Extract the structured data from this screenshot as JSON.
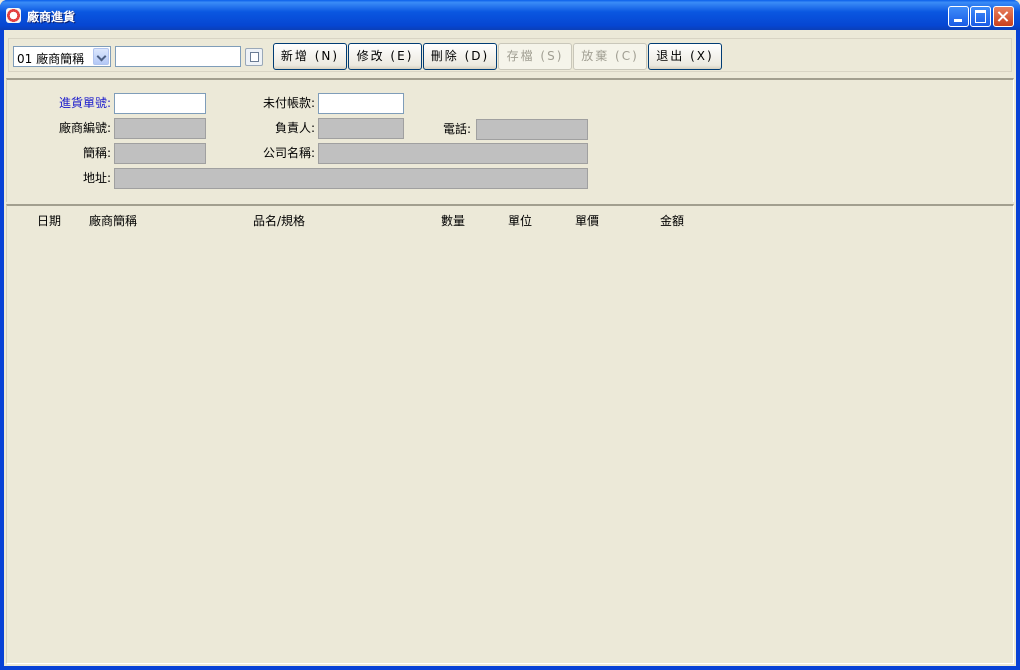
{
  "window": {
    "title": "廠商進貨"
  },
  "toolbar": {
    "combo_selected": "01 廠商簡稱",
    "search_value": "",
    "buttons": {
      "add": "新增 (N)",
      "edit": "修改 (E)",
      "delete": "刪除 (D)",
      "save": "存檔 (S)",
      "cancel": "放棄 (C)",
      "exit": "退出 (X)"
    }
  },
  "form": {
    "purchase_no_label": "進貨單號:",
    "purchase_no_value": "",
    "unpaid_label": "未付帳款:",
    "unpaid_value": "",
    "vendor_no_label": "廠商編號:",
    "vendor_no_value": "",
    "person_in_charge_label": "負責人:",
    "person_in_charge_value": "",
    "phone_label": "電話:",
    "phone_value": "",
    "short_name_label": "簡稱:",
    "short_name_value": "",
    "company_name_label": "公司名稱:",
    "company_name_value": "",
    "address_label": "地址:",
    "address_value": ""
  },
  "grid": {
    "columns": [
      "日期",
      "廠商簡稱",
      "品名/規格",
      "數量",
      "單位",
      "單價",
      "金額"
    ],
    "rows": []
  }
}
